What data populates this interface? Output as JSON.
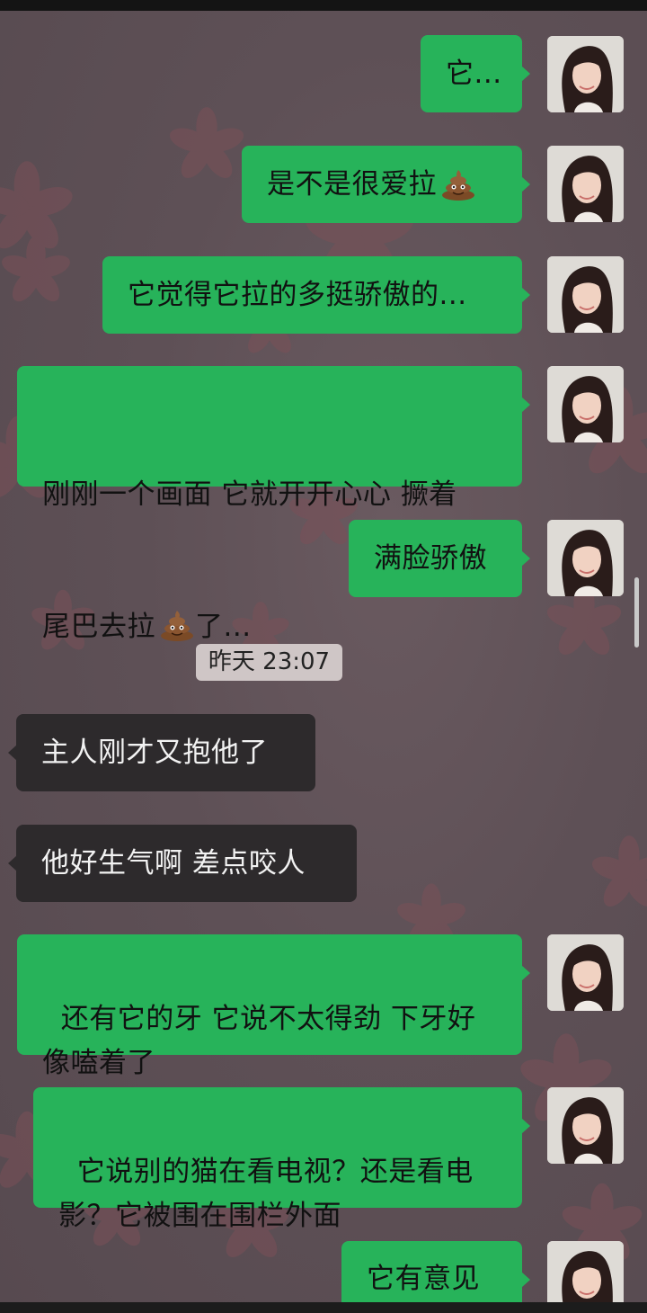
{
  "messages": [
    {
      "id": "m1",
      "side": "right",
      "text": "它...",
      "emoji": ""
    },
    {
      "id": "m2",
      "side": "right",
      "text": "是不是很爱拉",
      "emoji": "poop-emoji"
    },
    {
      "id": "m3",
      "side": "right",
      "text": "它觉得它拉的多挺骄傲的...",
      "emoji": ""
    },
    {
      "id": "m4",
      "side": "right",
      "line1": "刚刚一个画面 它就开开心心 撅着",
      "line2_a": "尾巴去拉",
      "emoji": "poop-emoji",
      "line2_b": "了..."
    },
    {
      "id": "m5",
      "side": "right",
      "text": "满脸骄傲",
      "emoji": ""
    },
    {
      "id": "m6",
      "side": "left",
      "text": "主人刚才又抱他了"
    },
    {
      "id": "m7",
      "side": "left",
      "text": "他好生气啊 差点咬人"
    },
    {
      "id": "m8",
      "side": "right",
      "text": "还有它的牙 它说不太得劲 下牙好\n像嗑着了"
    },
    {
      "id": "m9",
      "side": "right",
      "text": "它说别的猫在看电视？还是看电\n影？它被围在围栏外面"
    },
    {
      "id": "m10",
      "side": "right",
      "text": "它有意见"
    }
  ],
  "timestamp": "昨天 23:07",
  "colors": {
    "my_bubble": "#27b35a",
    "other_bubble": "#2d2a2c",
    "timestamp_bg": "#cfc6c6",
    "background": "#5d4f55"
  }
}
